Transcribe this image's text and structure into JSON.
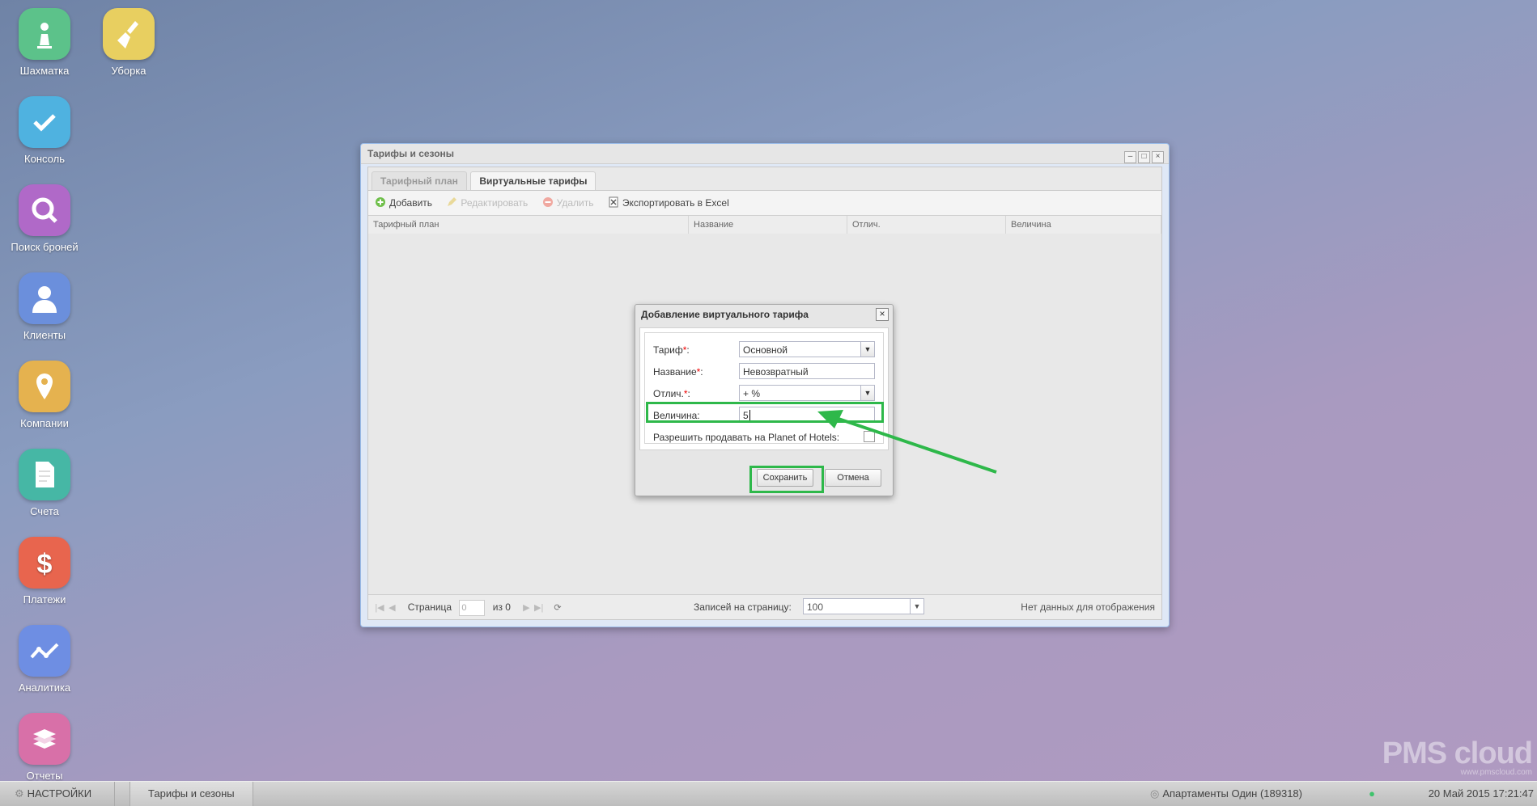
{
  "desktop": {
    "icons": [
      {
        "label": "Шахматка",
        "color": "#5cc28a"
      },
      {
        "label": "Уборка",
        "color": "#e8cf60"
      },
      {
        "label": "Консоль",
        "color": "#4fb2e0"
      },
      {
        "label": "Поиск броней",
        "color": "#b069c8"
      },
      {
        "label": "Клиенты",
        "color": "#6b8fdc"
      },
      {
        "label": "Компании",
        "color": "#e5b24f"
      },
      {
        "label": "Счета",
        "color": "#46b7a5"
      },
      {
        "label": "Платежи",
        "color": "#e8654e"
      },
      {
        "label": "Аналитика",
        "color": "#6e8ee3"
      },
      {
        "label": "Отчеты",
        "color": "#d870a8"
      }
    ]
  },
  "window": {
    "title": "Тарифы и сезоны",
    "tabs": [
      {
        "label": "Тарифный план",
        "active": false
      },
      {
        "label": "Виртуальные тарифы",
        "active": true
      }
    ],
    "toolbar": {
      "add": "Добавить",
      "edit": "Редактировать",
      "delete": "Удалить",
      "export": "Экспортировать в Excel"
    },
    "columns": [
      "Тарифный план",
      "Название",
      "Отлич.",
      "Величина"
    ],
    "pager": {
      "page_label": "Страница",
      "page_value": "0",
      "of_label": "из 0",
      "per_page_label": "Записей на страницу:",
      "per_page_value": "100",
      "empty_text": "Нет данных для отображения"
    }
  },
  "dialog": {
    "title": "Добавление виртуального тарифа",
    "fields": {
      "tariff_label": "Тариф",
      "tariff_value": "Основной",
      "name_label": "Название",
      "name_value": "Невозвратный",
      "diff_label": "Отлич.",
      "diff_value": "+ %",
      "amount_label": "Величина:",
      "amount_value": "5",
      "allow_label": "Разрешить продавать на Planet of Hotels:"
    },
    "save": "Сохранить",
    "cancel": "Отмена",
    "highlight_color": "#2eb84a"
  },
  "taskbar": {
    "settings": "НАСТРОЙКИ",
    "task": "Тарифы и сезоны",
    "hotel": "Апартаменты Один (189318)",
    "datetime": "20 Май 2015 17:21:47"
  },
  "watermark": {
    "brand": "PMS cloud",
    "url": "www.pmscloud.com"
  }
}
